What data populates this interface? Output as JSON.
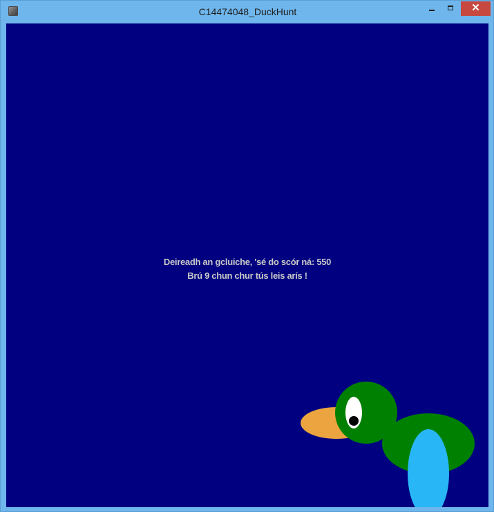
{
  "window": {
    "title": "C14474048_DuckHunt",
    "icon": "app-icon",
    "controls": {
      "minimize_icon": "minimize-icon",
      "maximize_icon": "maximize-icon",
      "close_label": "✕"
    }
  },
  "game": {
    "background_color": "#000080",
    "game_over_line": "Deireadh an gcluiche, 'sé do scór ná: 550",
    "restart_line": "Brú  9 chun chur tús leis arís !"
  },
  "duck": {
    "body_color": "#008000",
    "beak_color": "#eba43f",
    "belly_color": "#29b6f6",
    "eye_color": "#ffffff",
    "pupil_color": "#000000"
  }
}
